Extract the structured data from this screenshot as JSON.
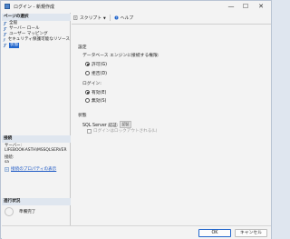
{
  "window": {
    "title": "ログイン - 新規作成",
    "minimize_glyph": "—",
    "maximize_glyph": "☐",
    "close_glyph": "✕"
  },
  "sidebar": {
    "pages_header": "ページの選択",
    "pages": [
      {
        "label": "全般",
        "icon": "wrench-icon",
        "selected": false
      },
      {
        "label": "サーバー ロール",
        "icon": "wrench-icon",
        "selected": false
      },
      {
        "label": "ユーザー マッピング",
        "icon": "wrench-icon",
        "selected": false
      },
      {
        "label": "セキュリティ保護可能なリソース",
        "icon": "wrench-icon",
        "selected": false
      },
      {
        "label": "状態",
        "icon": "wrench-icon",
        "selected": true
      }
    ],
    "connection_header": "接続",
    "server_label": "サーバー:",
    "server_value": "LIFEBOOK-ASTH\\MSSQLSERVER",
    "connection_label": "接続:",
    "connection_value": "sa",
    "connection_properties_link": "接続のプロパティの表示",
    "progress_header": "進行状況",
    "progress_status": "準備完了"
  },
  "toolbar": {
    "script_label": "スクリプト",
    "help_label": "ヘルプ"
  },
  "settings": {
    "section_title": "設定",
    "db_permission_label": "データベース エンジンに接続する権限:",
    "grant_label": "許可(G)",
    "grant_checked": true,
    "deny_label": "拒否(D)",
    "deny_checked": false,
    "login_label": "ログイン:",
    "enabled_label": "有効(E)",
    "enabled_checked": true,
    "disabled_label": "無効(S)",
    "disabled_checked": false
  },
  "status": {
    "section_title": "状態",
    "sql_server_auth_label": "SQL Server 認証:",
    "sql_server_auth_badge": "認証",
    "locked_out_label": "ログインはロックアウトされる(L)",
    "locked_out_checked": false
  },
  "footer": {
    "ok_label": "OK",
    "cancel_label": "キャンセル"
  },
  "colors": {
    "accent": "#2266cc",
    "section_header_bg": "#dfe6ef",
    "link": "#1a56c4"
  }
}
